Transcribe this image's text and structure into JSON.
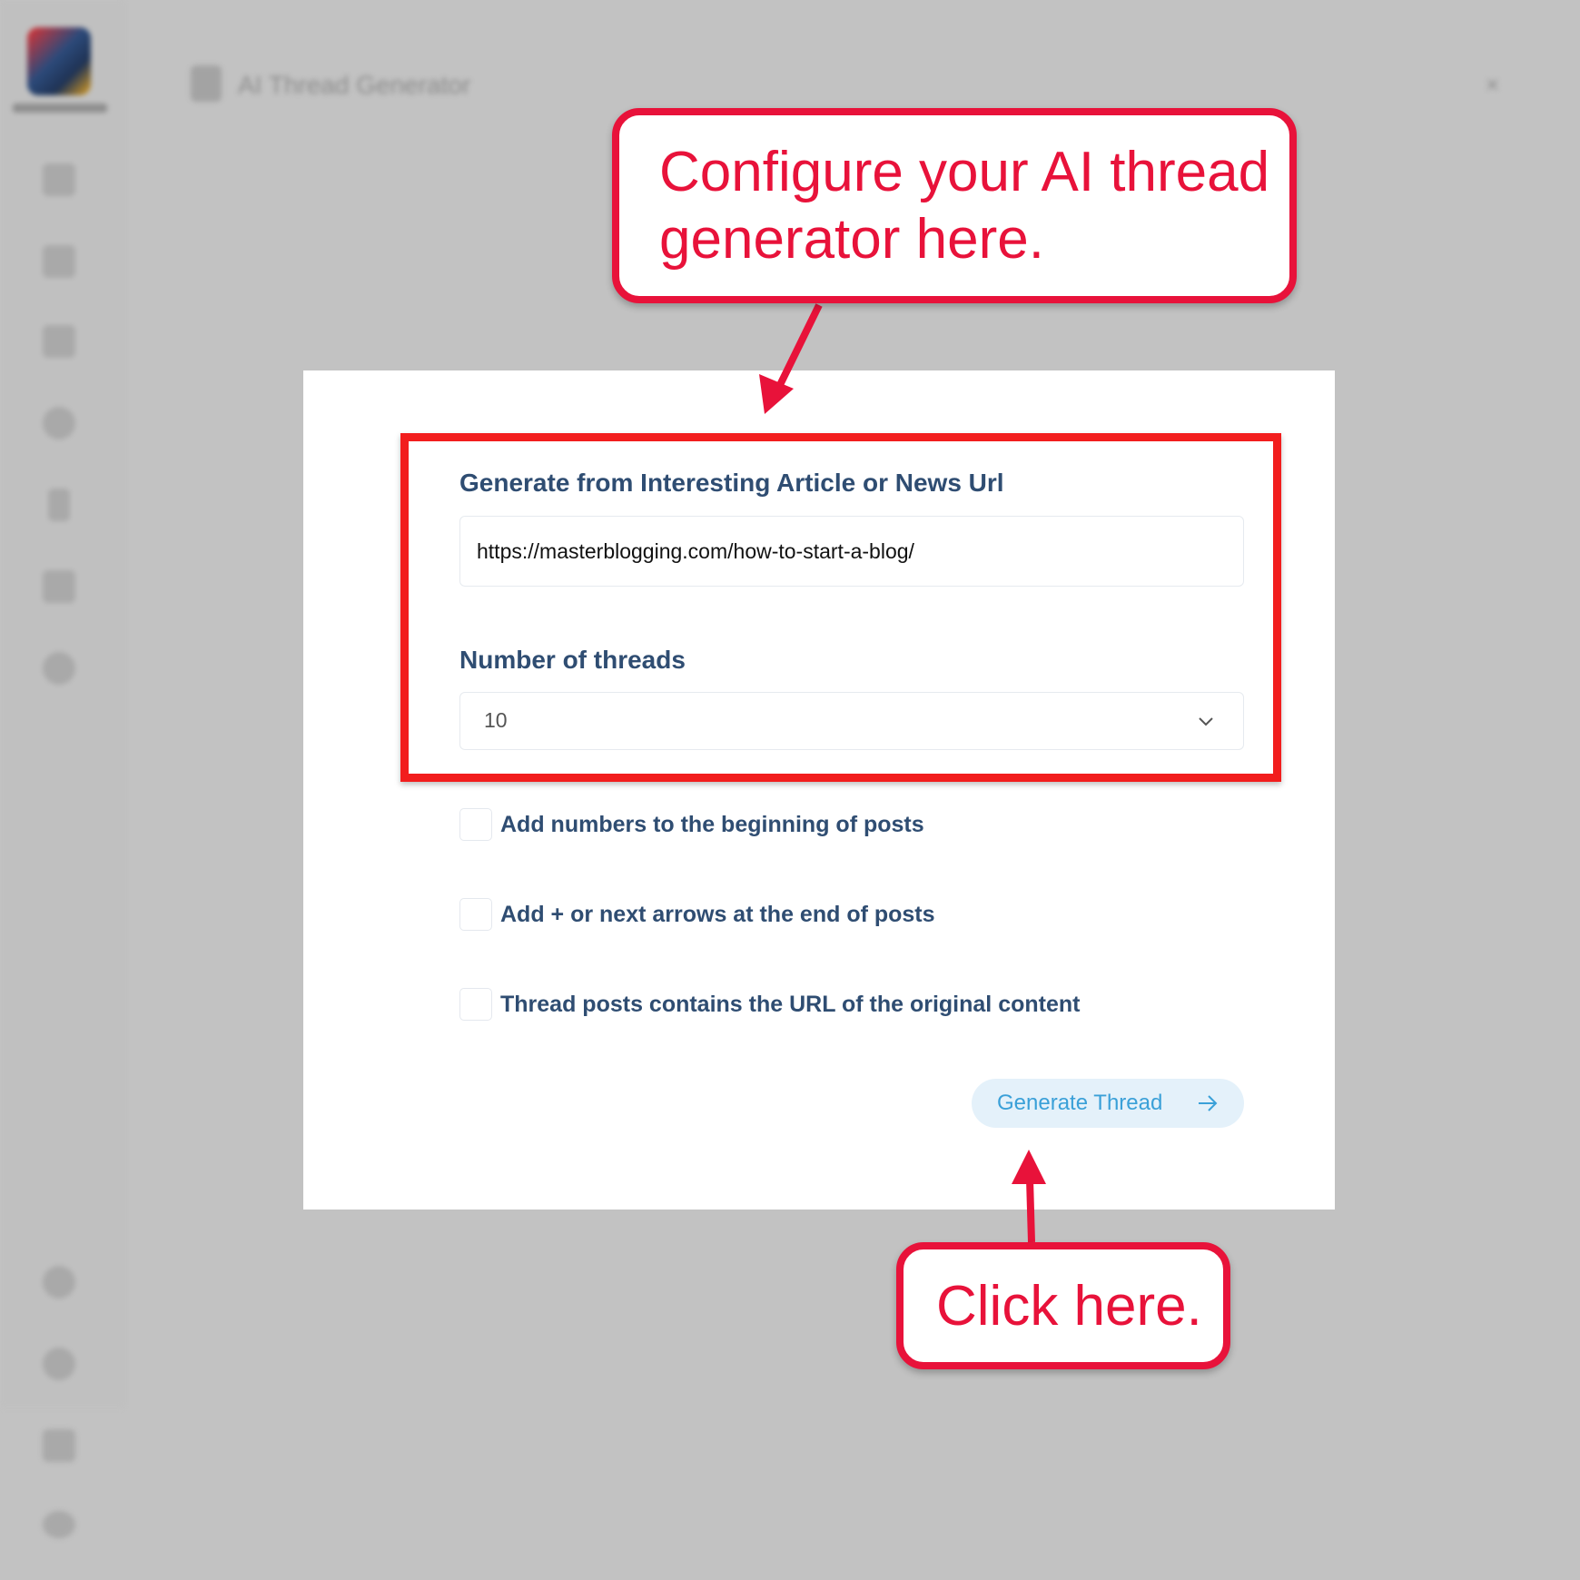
{
  "app": {
    "header_title": "AI Thread Generator",
    "close_glyph": "×",
    "sidebar_icons": [
      "dashboard-icon",
      "compose-icon",
      "chat-icon",
      "link-icon",
      "rss-icon",
      "edit-icon",
      "clock-icon",
      "twitter-icon",
      "help-icon",
      "notification-icon",
      "settings-icon"
    ]
  },
  "form": {
    "url_label": "Generate from Interesting Article or News Url",
    "url_value": "https://masterblogging.com/how-to-start-a-blog/",
    "threads_label": "Number of threads",
    "threads_value": "10",
    "options": [
      {
        "label": "Add numbers to the beginning of posts",
        "checked": false
      },
      {
        "label": "Add + or next arrows at the end of posts",
        "checked": false
      },
      {
        "label": "Thread posts contains the URL of the original content",
        "checked": false
      }
    ],
    "generate_button": "Generate Thread"
  },
  "annotations": {
    "callout_top": "Configure your AI thread generator here.",
    "callout_bottom": "Click here.",
    "accent_color": "#e8123a",
    "box_color": "#f21d1d"
  },
  "colors": {
    "label": "#2f4d72",
    "button_bg": "#e4f1fa",
    "button_text": "#3aa0d8"
  }
}
